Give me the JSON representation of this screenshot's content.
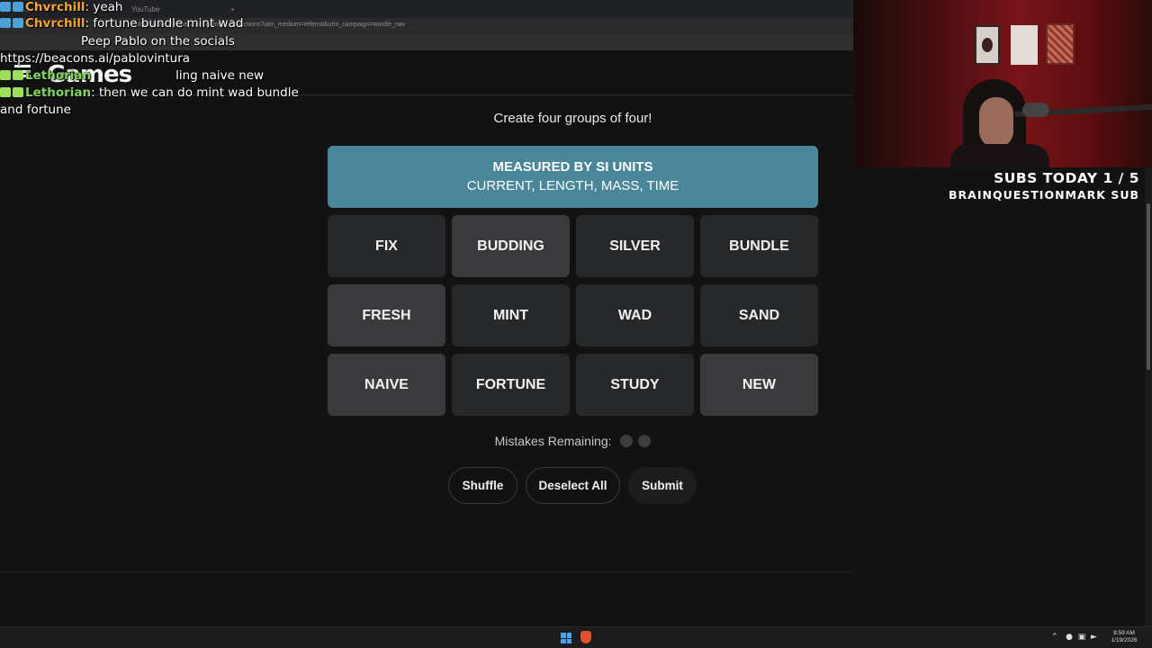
{
  "browser": {
    "tabs": [
      "...",
      "...",
      "YouTube"
    ],
    "url_fragment": "https://www.nytimes.com/games/connections?utm_medium=referral&utm_campaign=wordle_nav",
    "site_logo": "Games"
  },
  "chat": [
    {
      "user": "Chvrchill",
      "message": ": yeah",
      "user_color": "#f5a623"
    },
    {
      "user": "Chvrchill",
      "message": ": fortune bundle mint wad",
      "user_color": "#f5a623"
    },
    {
      "user": "",
      "message": "Peep Pablo on the socials",
      "user_color": "#ff4a4a"
    },
    {
      "user": "",
      "message": "https://beacons.ai/pablovintura",
      "user_color": "#ffffff"
    },
    {
      "user": "Lethorian",
      "message": "ling naive new",
      "user_color": "#7ed957"
    },
    {
      "user": "Lethorian",
      "message": ": then we can do mint wad bundle",
      "user_color": "#7ed957"
    },
    {
      "user": "",
      "message": "and fortune",
      "user_color": "#ffffff"
    }
  ],
  "game": {
    "instructions": "Create four groups of four!",
    "solved_group": {
      "title": "MEASURED BY SI UNITS",
      "words": "CURRENT, LENGTH, MASS, TIME",
      "color": "#4a8699"
    },
    "tiles": [
      {
        "label": "FIX",
        "selected": false
      },
      {
        "label": "BUDDING",
        "selected": true
      },
      {
        "label": "SILVER",
        "selected": false
      },
      {
        "label": "BUNDLE",
        "selected": false
      },
      {
        "label": "FRESH",
        "selected": true
      },
      {
        "label": "MINT",
        "selected": false
      },
      {
        "label": "WAD",
        "selected": false
      },
      {
        "label": "SAND",
        "selected": false
      },
      {
        "label": "NAIVE",
        "selected": true
      },
      {
        "label": "FORTUNE",
        "selected": false
      },
      {
        "label": "STUDY",
        "selected": false
      },
      {
        "label": "NEW",
        "selected": true
      }
    ],
    "mistakes_label": "Mistakes Remaining:",
    "mistakes_remaining": 2,
    "buttons": {
      "shuffle": "Shuffle",
      "deselect": "Deselect All",
      "submit": "Submit"
    }
  },
  "stream_overlay": {
    "subs_today": "SUBS TODAY 1 / 5",
    "sub_name": "BRAINQUESTIONMARK SUB"
  },
  "taskbar": {
    "time": "8:59 AM",
    "date": "1/19/2026",
    "tray_icons": [
      "chevron-up-icon",
      "mic-icon",
      "network-icon",
      "volume-icon"
    ]
  }
}
